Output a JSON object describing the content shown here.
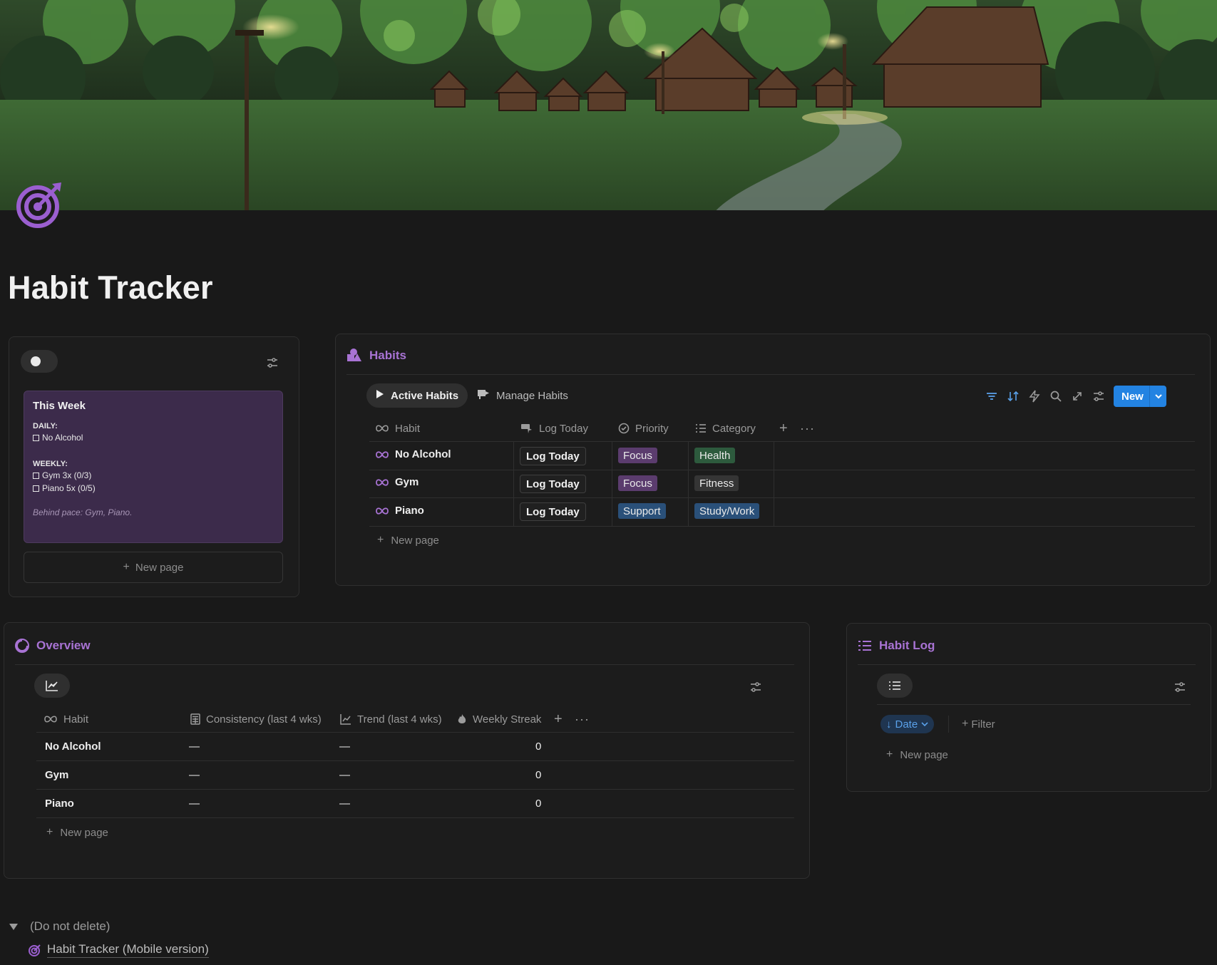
{
  "page": {
    "title": "Habit Tracker"
  },
  "week_card": {
    "title": "This Week",
    "daily_heading": "DAILY:",
    "daily_items": [
      "No Alcohol"
    ],
    "weekly_heading": "WEEKLY:",
    "weekly_items": [
      "Gym 3x (0/3)",
      "Piano 5x (0/5)"
    ],
    "note": "Behind pace: Gym, Piano.",
    "new_page_label": "New page"
  },
  "habits_db": {
    "title": "Habits",
    "tabs": [
      {
        "label": "Active Habits",
        "active": true
      },
      {
        "label": "Manage Habits",
        "active": false
      }
    ],
    "new_button_label": "New",
    "columns": [
      "Habit",
      "Log Today",
      "Priority",
      "Category"
    ],
    "rows": [
      {
        "habit": "No Alcohol",
        "log": "Log Today",
        "priority": "Focus",
        "category": "Health"
      },
      {
        "habit": "Gym",
        "log": "Log Today",
        "priority": "Focus",
        "category": "Fitness"
      },
      {
        "habit": "Piano",
        "log": "Log Today",
        "priority": "Support",
        "category": "Study/Work"
      }
    ],
    "new_page_label": "New page",
    "colors": {
      "accent": "#a873d4",
      "new_button": "#2383e2"
    }
  },
  "overview": {
    "title": "Overview",
    "columns": [
      "Habit",
      "Consistency (last 4 wks)",
      "Trend (last 4 wks)",
      "Weekly Streak"
    ],
    "rows": [
      {
        "habit": "No Alcohol",
        "consistency": "—",
        "trend": "—",
        "streak": "0"
      },
      {
        "habit": "Gym",
        "consistency": "—",
        "trend": "—",
        "streak": "0"
      },
      {
        "habit": "Piano",
        "consistency": "—",
        "trend": "—",
        "streak": "0"
      }
    ],
    "new_page_label": "New page"
  },
  "habit_log": {
    "title": "Habit Log",
    "sort_label": "Date",
    "filter_label": "Filter",
    "new_page_label": "New page"
  },
  "footer": {
    "toggle_label": "(Do not delete)",
    "mobile_link": "Habit Tracker (Mobile version)"
  }
}
